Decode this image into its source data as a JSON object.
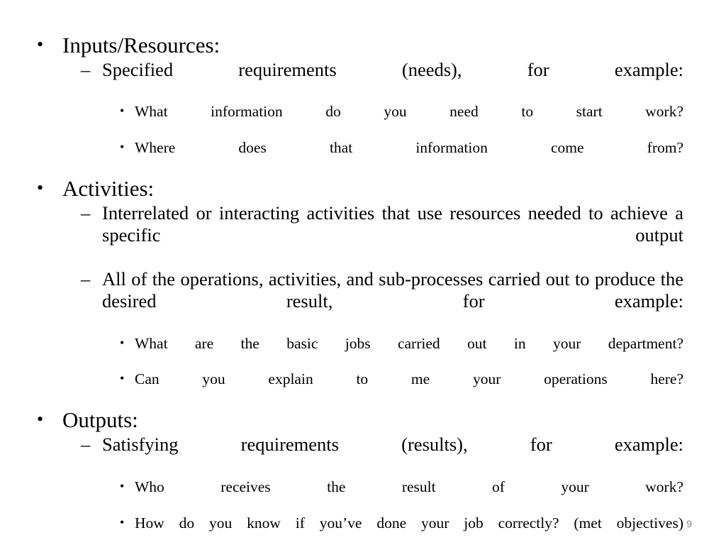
{
  "slide": {
    "page_number": "9",
    "background_color": "#ffffff",
    "text_color": "#000000",
    "page_number_color": "#808080",
    "bullet_glyph_level1": "•",
    "bullet_glyph_level2": "–",
    "bullet_glyph_level3": "•",
    "content": [
      {
        "level": 1,
        "text": "Inputs/Resources:"
      },
      {
        "level": 2,
        "text": "Specified requirements (needs), for example:"
      },
      {
        "level": 3,
        "text": "What information do you need to start work?"
      },
      {
        "level": 3,
        "text": "Where does that information come from?"
      },
      {
        "level": 1,
        "text": "Activities:"
      },
      {
        "level": 2,
        "text": "Interrelated or interacting activities that use resources needed to achieve a specific output"
      },
      {
        "level": 2,
        "text": "All of the operations, activities, and sub-processes carried out to produce the desired result, for example:"
      },
      {
        "level": 3,
        "text": "What are the basic jobs carried out in your department?"
      },
      {
        "level": 3,
        "text": "Can you explain to me your operations here?"
      },
      {
        "level": 1,
        "text": "Outputs:"
      },
      {
        "level": 2,
        "text": "Satisfying requirements (results), for example:"
      },
      {
        "level": 3,
        "text": "Who receives the result of your work?"
      },
      {
        "level": 3,
        "text": "How do you know if you’ve done your job correctly? (met objectives)"
      }
    ]
  }
}
